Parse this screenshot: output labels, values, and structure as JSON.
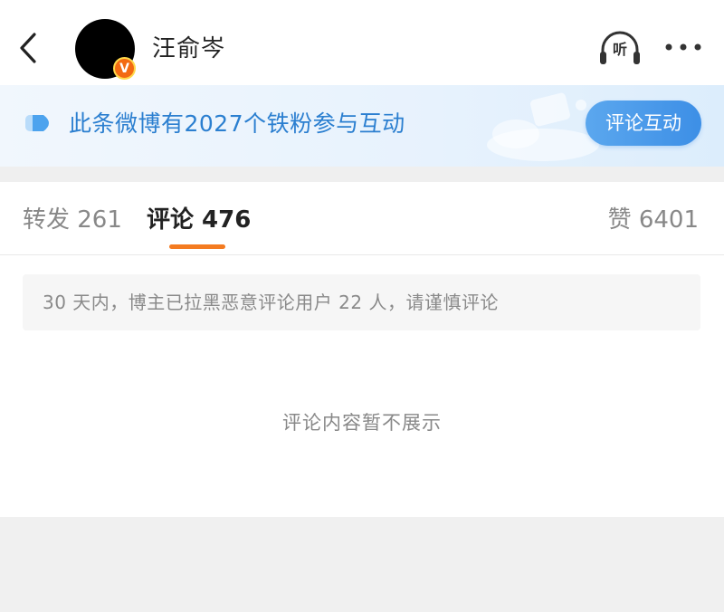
{
  "header": {
    "author_name": "汪俞岑",
    "verified_badge": "V",
    "listen_label": "听"
  },
  "banner": {
    "text": "此条微博有2027个铁粉参与互动",
    "button_label": "评论互动"
  },
  "tabs": {
    "repost": "转发 261",
    "comment": "评论 476",
    "like": "赞 6401",
    "active": "comment"
  },
  "notice": "30 天内，博主已拉黑恶意评论用户 22 人，请谨慎评论",
  "empty_message": "评论内容暂不展示",
  "colors": {
    "accent_blue": "#2b7fd0",
    "tab_indicator": "#f47b20",
    "verified_orange": "#f36a12"
  }
}
